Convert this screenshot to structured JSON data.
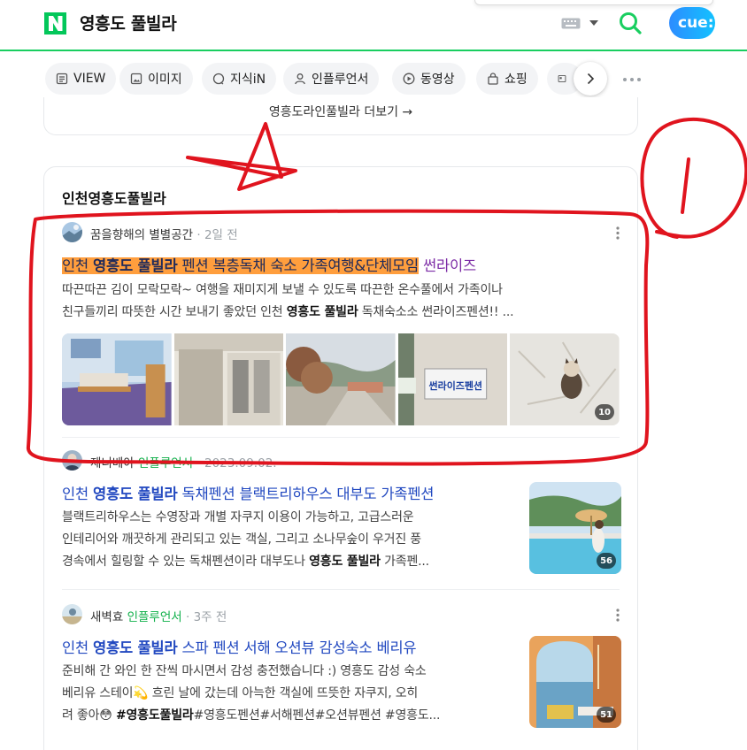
{
  "search": {
    "query": "영흥도 풀빌라"
  },
  "header": {
    "cue_label": "cue:"
  },
  "tabs": [
    {
      "label": "VIEW",
      "icon": "view-icon"
    },
    {
      "label": "이미지",
      "icon": "image-icon"
    },
    {
      "label": "지식iN",
      "icon": "knowledge-icon"
    },
    {
      "label": "인플루언서",
      "icon": "person-icon"
    },
    {
      "label": "동영상",
      "icon": "play-icon"
    },
    {
      "label": "쇼핑",
      "icon": "bag-icon"
    }
  ],
  "prev_section": {
    "more_label": "영흥도라인풀빌라 더보기"
  },
  "section": {
    "title": "인천영흥도풀빌라",
    "posts": [
      {
        "author": "꿈을향해의 별별공간",
        "badge": "",
        "time": "2일 전",
        "title_pre": "인천 ",
        "title_bold": "영흥도 풀빌라",
        "title_post": " 펜션 복층독채 숙소 가족여행&단체모임",
        "title_extra": " 썬라이즈",
        "snippet_1": "따끈따끈 김이 모락모락~ 여행을 재미지게 보낼 수 있도록 따끈한 온수풀에서 가족이나",
        "snippet_2a": "친구들끼리 따뜻한 시간 보내기 좋았던 인천 ",
        "snippet_2b": "영흥도 풀빌라",
        "snippet_2c": " 독채숙소소 썬라이즈펜션!! ...",
        "image_count": "10",
        "sign_text": "썬라이즈펜션"
      },
      {
        "author": "제니베아",
        "badge": "인플루언서",
        "time": "2023.09.02.",
        "title_pre": "인천 ",
        "title_bold": "영흥도 풀빌라",
        "title_post": " 독채펜션 블랙트리하우스 대부도 가족펜션",
        "snippet_1": "블랙트리하우스는 수영장과 개별 자쿠지 이용이 가능하고, 고급스러운",
        "snippet_2": "인테리어와 깨끗하게 관리되고 있는 객실, 그리고 소나무숲이 우거진 풍",
        "snippet_3a": "경속에서 힐링할 수 있는 독채펜션이라 대부도나 ",
        "snippet_3b": "영흥도 풀빌라",
        "snippet_3c": " 가족펜...",
        "image_count": "56"
      },
      {
        "author": "새벽효",
        "badge": "인플루언서",
        "time": "3주 전",
        "title_pre": "인천 ",
        "title_bold": "영흥도 풀빌라",
        "title_post": " 스파 펜션 서해 오션뷰 감성숙소 베리유",
        "snippet_1": "준비해 간 와인 한 잔씩 마시면서 감성 충전했습니다 :) 영흥도 감성 숙소",
        "snippet_2": "베리유 스테이💫 흐린 날에 갔는데 아늑한 객실에 뜨뜻한 자쿠지, 오히",
        "snippet_3a": "려 좋아😳 ",
        "snippet_3b": "#영흥도풀빌라",
        "snippet_3c": "#영흥도펜션#서해펜션#오션뷰펜션 #영흥도...",
        "image_count": "51"
      }
    ]
  },
  "annotation": {
    "number": "1"
  },
  "colors": {
    "naver_green": "#19ce60",
    "link_blue": "#2148c0",
    "highlight": "#ff9e3d",
    "annotation_red": "#e0141e"
  }
}
